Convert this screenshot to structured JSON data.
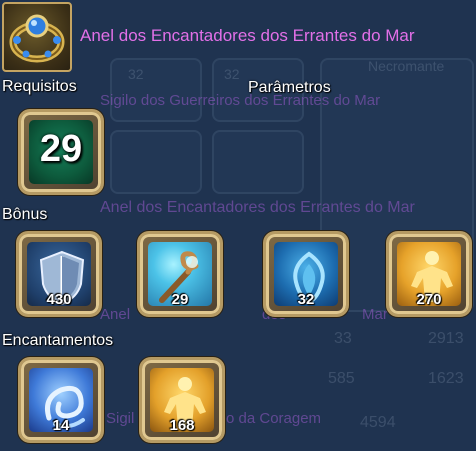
{
  "item": {
    "title": "Anel dos Encantadores dos Errantes do Mar",
    "icon": "ring-icon"
  },
  "sections": {
    "requirements": "Requisitos",
    "parameters": "Parâmetros",
    "bonus": "Bônus",
    "enchantments": "Encantamentos"
  },
  "requirement": {
    "level": "29",
    "icon": "level-badge"
  },
  "bonus_slots": [
    {
      "icon": "shield-icon",
      "value": "430"
    },
    {
      "icon": "magic-staff-icon",
      "value": "29"
    },
    {
      "icon": "blue-aura-icon",
      "value": "32"
    },
    {
      "icon": "golden-figure-icon",
      "value": "270"
    }
  ],
  "enchant_slots": [
    {
      "icon": "blue-swirl-icon",
      "value": "14"
    },
    {
      "icon": "golden-figure-icon",
      "value": "168"
    }
  ],
  "background": {
    "overlay_lines": [
      "Sigilo dos Guerreiros dos Errantes do Mar",
      "Anel dos Encantadores dos Errantes do Mar",
      "Anel",
      "dos",
      "Mar",
      "Sigil",
      "o da Coragem"
    ],
    "class_label": "Necromante",
    "faint_values": [
      "32",
      "32",
      "33",
      "2913",
      "585",
      "1623",
      "4594"
    ]
  },
  "colors": {
    "title": "#e270e8",
    "frame_gold": "#c4a462",
    "backdrop": "#1f3350"
  }
}
